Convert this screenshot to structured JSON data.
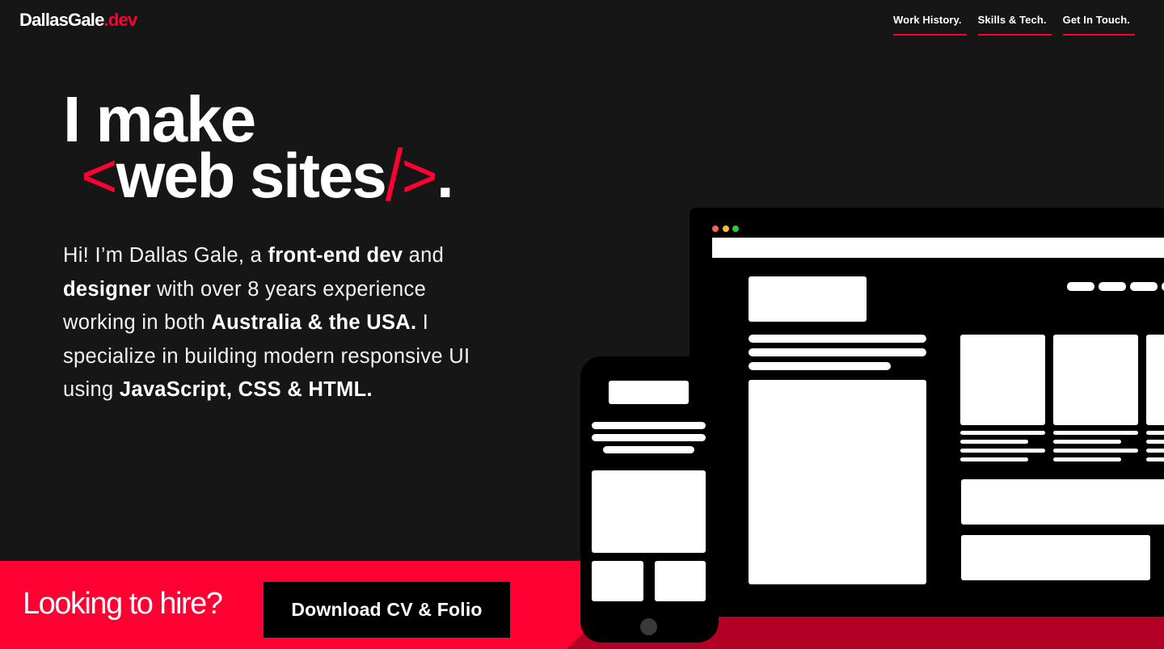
{
  "header": {
    "logo_main": "DallasGale",
    "logo_accent": ".dev",
    "nav": [
      {
        "label": "Work History."
      },
      {
        "label": "Skills & Tech."
      },
      {
        "label": "Get In Touch."
      }
    ]
  },
  "hero": {
    "line1": "I make",
    "tag_open": "<",
    "line2_text": "web sites",
    "tag_slash": "/",
    "tag_close": ">",
    "period": ".",
    "intro": {
      "p1": "Hi! I’m Dallas Gale, a ",
      "b1": "front-end dev",
      "p2": " and ",
      "b2": "designer",
      "p3": " with over 8 years experience working in both ",
      "b3": "Australia & the USA.",
      "p4": " I specialize in building modern responsive UI using ",
      "b4": "JavaScript, CSS & HTML."
    }
  },
  "banner": {
    "hire_text": "Looking to hire?",
    "cta_label": "Download CV & Folio"
  },
  "colors": {
    "accent": "#ff0033",
    "background": "#161616",
    "banner_dark": "#b50026",
    "mockup_dot_red": "#ff5f56",
    "mockup_dot_yellow": "#ffbd2e",
    "mockup_dot_green": "#27c93f"
  }
}
